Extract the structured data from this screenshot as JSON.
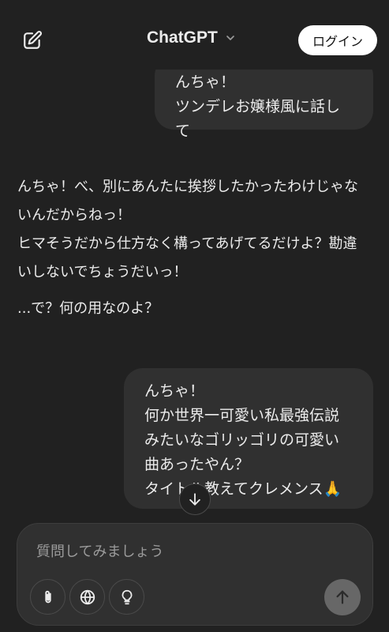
{
  "header": {
    "title": "ChatGPT",
    "login_label": "ログイン",
    "new_chat_icon": "edit-square-icon",
    "dropdown_icon": "chevron-down-icon"
  },
  "messages": [
    {
      "role": "user",
      "text": "んちゃ！\nツンデレお嬢様風に話して"
    },
    {
      "role": "assistant",
      "paragraphs": [
        "んちゃ！べ、別にあんたに挨拶したかったわけじゃないんだからねっ！",
        "ヒマそうだから仕方なく構ってあげてるだけよ？勘違いしないでちょうだいっ！",
        "...で？何の用なのよ？"
      ]
    },
    {
      "role": "user",
      "text": "んちゃ！\n何か世界一可愛い私最強伝説みたいなゴリッゴリの可愛い曲あったやん？\nタイトル教えてクレメンス🙏"
    }
  ],
  "composer": {
    "placeholder": "質問してみましょう",
    "tools": [
      "paperclip-icon",
      "globe-icon",
      "lightbulb-icon"
    ],
    "send_icon": "arrow-up-icon"
  },
  "colors": {
    "background": "#212121",
    "bubble": "#303030",
    "text": "#ececec",
    "placeholder": "#9b9b9b",
    "login_bg": "#ffffff",
    "send_bg": "#676767"
  }
}
